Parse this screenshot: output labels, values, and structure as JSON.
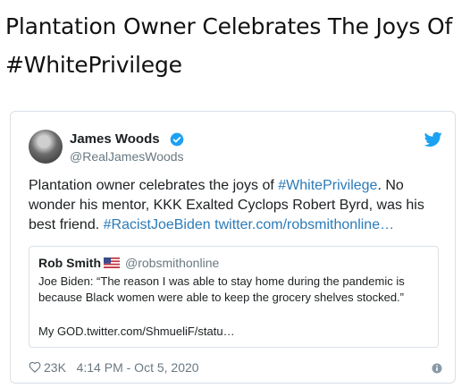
{
  "headline": {
    "line1": "Plantation Owner Celebrates The Joys Of",
    "line2": "#WhitePrivilege"
  },
  "tweet": {
    "author_name": "James Woods",
    "author_handle": "@RealJamesWoods",
    "text_1": "Plantation owner celebrates the joys of ",
    "hashtag_1": "#WhitePrivilege",
    "text_2": ". No wonder his  mentor, KKK Exalted Cyclops Robert Byrd, was his best friend.",
    "hashtag_2": "#RacistJoeBiden",
    "link": "twitter.com/robsmithonline…",
    "likes": "23K",
    "timestamp": "4:14 PM - Oct 5, 2020"
  },
  "quoted_tweet": {
    "author_name": "Rob Smith",
    "author_handle": "@robsmithonline",
    "text": "Joe Biden: “The reason I was able to stay home during the pandemic is because Black women were able to keep the grocery shelves stocked.”",
    "footer": "My GOD.twitter.com/ShmueliF/statu…"
  },
  "icons": {
    "verified": "verified-badge-icon",
    "bird": "twitter-bird-icon",
    "flag": "us-flag-icon",
    "heart": "heart-icon",
    "info": "info-icon"
  },
  "colors": {
    "link": "#2b7bb9",
    "verified": "#1da1f2",
    "muted": "#697882"
  }
}
